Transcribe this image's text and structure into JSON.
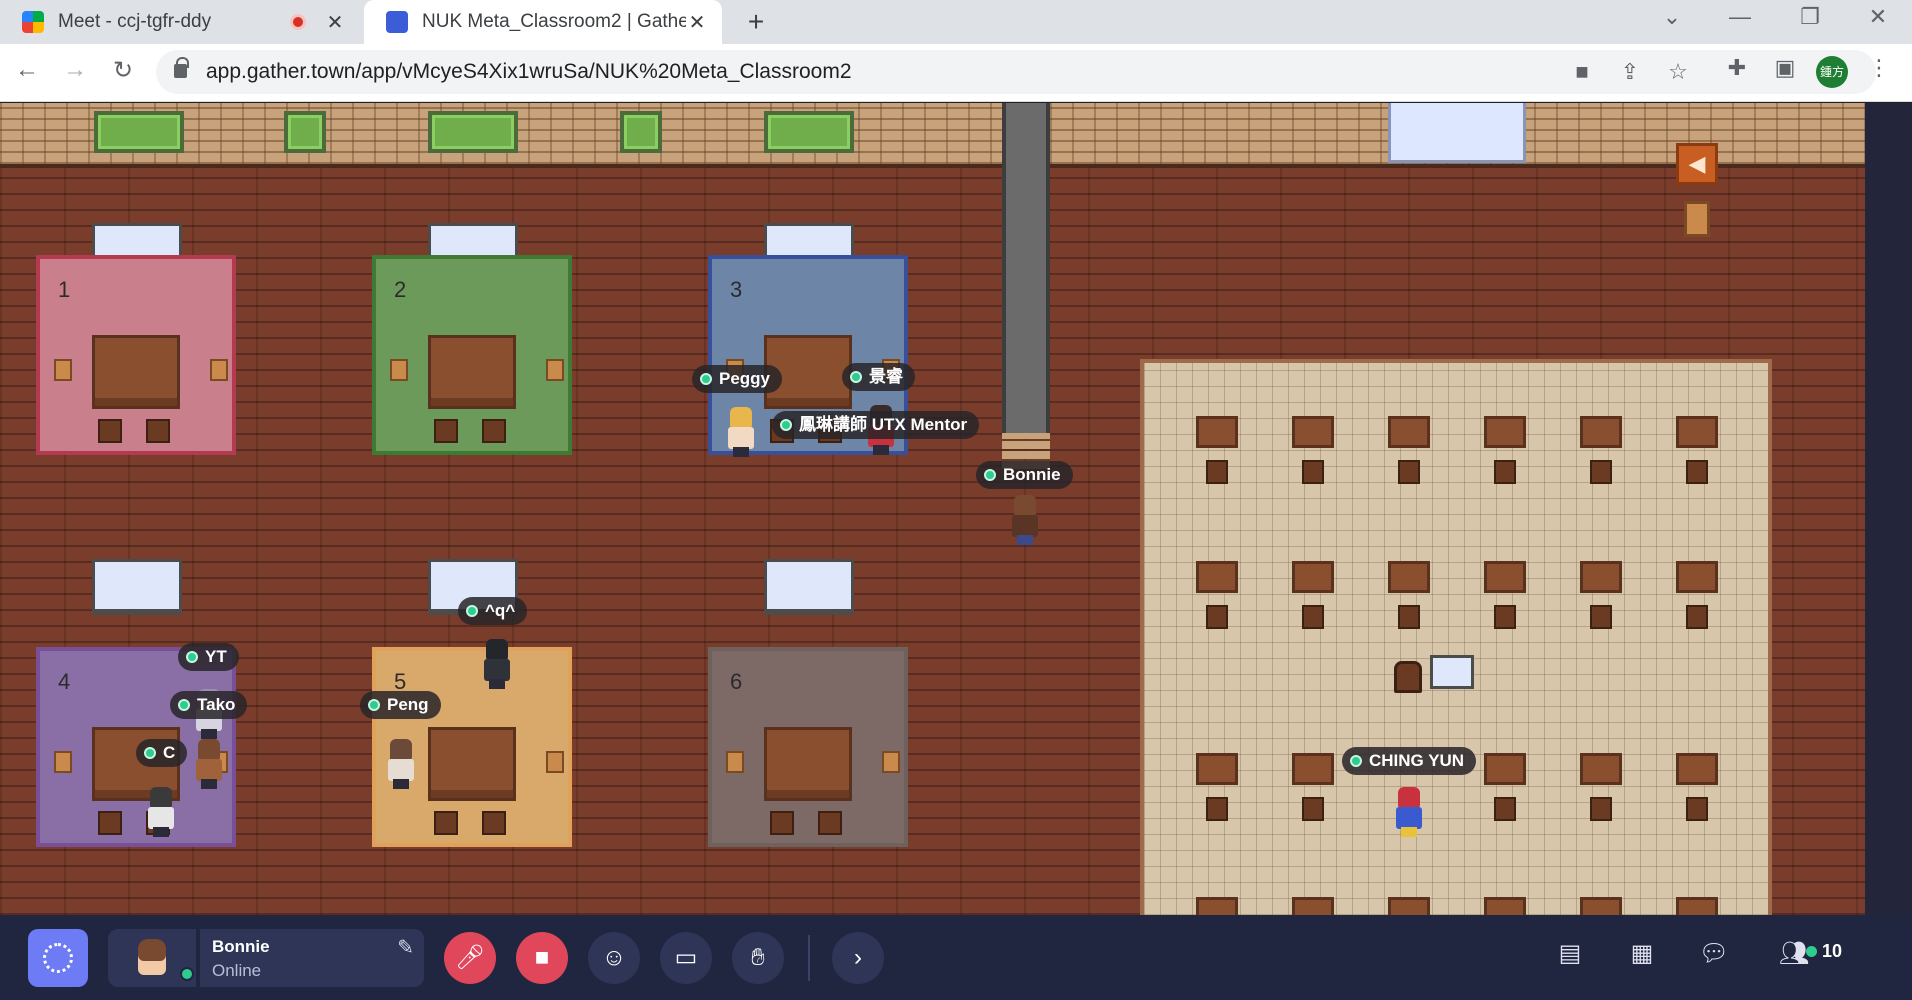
{
  "browser": {
    "tabs": [
      {
        "title": "Meet - ccj-tgfr-ddy",
        "recording": true,
        "active": false
      },
      {
        "title": "NUK Meta_Classroom2 | Gathe",
        "recording": false,
        "active": true
      }
    ],
    "new_tab": "+",
    "url": "app.gather.town/app/vMcyeS4Xix1wruSa/NUK%20Meta_Classroom2",
    "profile_initials": "鍾方",
    "icons": [
      "back-icon",
      "forward-icon",
      "reload-icon",
      "lock-icon",
      "camera-icon",
      "share-icon",
      "star-icon",
      "extensions-icon",
      "sidepanel-icon",
      "menu-icon"
    ]
  },
  "map": {
    "rooms": [
      {
        "number": "1",
        "rug_color": "#c9808c",
        "border_color": "#b33a4f"
      },
      {
        "number": "2",
        "rug_color": "#6c9a5a",
        "border_color": "#3f7a32"
      },
      {
        "number": "3",
        "rug_color": "#6d86a8",
        "border_color": "#3a4f9a"
      },
      {
        "number": "4",
        "rug_color": "#8a6fa6",
        "border_color": "#7a4f9a"
      },
      {
        "number": "5",
        "rug_color": "#d9a96b",
        "border_color": "#e0a25a"
      },
      {
        "number": "6",
        "rug_color": "#7d6a66",
        "border_color": "#6e625e"
      }
    ],
    "players": [
      {
        "name": "Peggy"
      },
      {
        "name": "景睿"
      },
      {
        "name": "鳳琳講師 UTX Mentor"
      },
      {
        "name": "Bonnie"
      },
      {
        "name": "^q^"
      },
      {
        "name": "YT"
      },
      {
        "name": "Tako"
      },
      {
        "name": "C"
      },
      {
        "name": "Peng"
      },
      {
        "name": "CHING YUN"
      }
    ]
  },
  "bottom_bar": {
    "user": {
      "name": "Bonnie",
      "status": "Online"
    },
    "controls": [
      "mic-muted-icon",
      "camera-off-icon",
      "emoji-icon",
      "screen-share-icon",
      "raise-hand-icon",
      "expand-icon"
    ],
    "right_controls": [
      "calendar-icon",
      "chat-icon",
      "people-icon"
    ],
    "online_count": "10"
  },
  "colors": {
    "accent": "#6d7bf4",
    "online": "#2ecc8f",
    "danger": "#e0475b",
    "bar": "#202540"
  }
}
